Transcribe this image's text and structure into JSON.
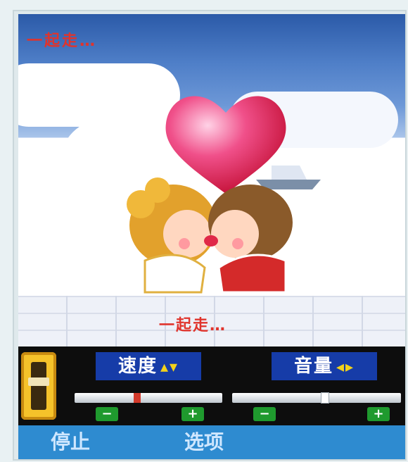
{
  "scene": {
    "caption_top": "一起走…",
    "caption_bottom": "一起走…"
  },
  "controls": {
    "speed": {
      "label": "速度",
      "arrows": "▴▾",
      "level": 0.42
    },
    "volume": {
      "label": "音量",
      "arrows": "◂▸",
      "level": 0.55
    },
    "decrease": "−",
    "increase": "+"
  },
  "softkeys": {
    "left": "停止",
    "right": "选项"
  },
  "colors": {
    "accent_red": "#e0342c",
    "panel_blue": "#163ca8",
    "softkey_blue": "#2e8bd0",
    "button_green": "#1f9a2e"
  }
}
